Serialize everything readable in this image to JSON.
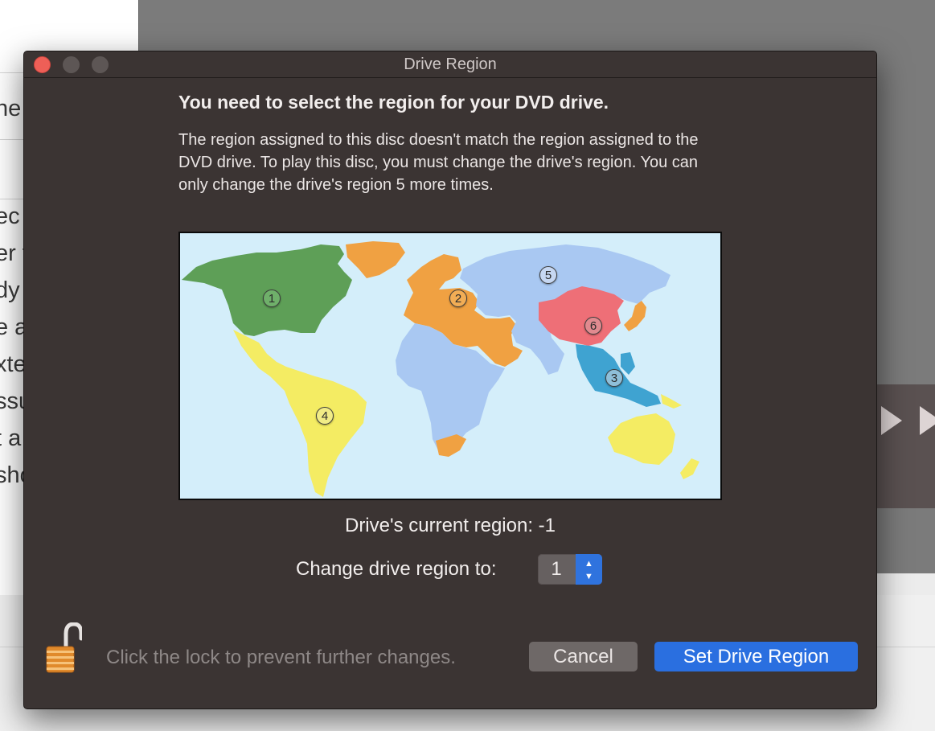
{
  "window": {
    "title": "Drive Region"
  },
  "dialog": {
    "heading": "You need to select the region for your DVD drive.",
    "message": "The region assigned to this disc doesn't match the region assigned to the DVD drive. To play this disc, you must change the drive's region. You can only change the drive's region 5 more times.",
    "current_region_text": "Drive's current region: -1",
    "change_label": "Change drive region to:",
    "selected_region": "1",
    "lock_hint": "Click the lock to prevent further changes.",
    "cancel_label": "Cancel",
    "primary_label": "Set Drive Region"
  },
  "map": {
    "markers": [
      "1",
      "2",
      "3",
      "4",
      "5",
      "6"
    ],
    "region_colors": {
      "1": "#5e9f57",
      "2": "#f0a142",
      "3": "#3fa3d1",
      "4": "#f4ec63",
      "5": "#a9c8f2",
      "6": "#ee6f77"
    },
    "ocean_color": "#d4eefa"
  },
  "background": {
    "side_text": [
      "he",
      "ec",
      "er t",
      "dy",
      "e a",
      "xte",
      "ssu",
      "t a",
      "sho"
    ]
  },
  "colors": {
    "dialog_bg": "#3b3433",
    "accent": "#2a6fe0",
    "close": "#ee5f57"
  }
}
